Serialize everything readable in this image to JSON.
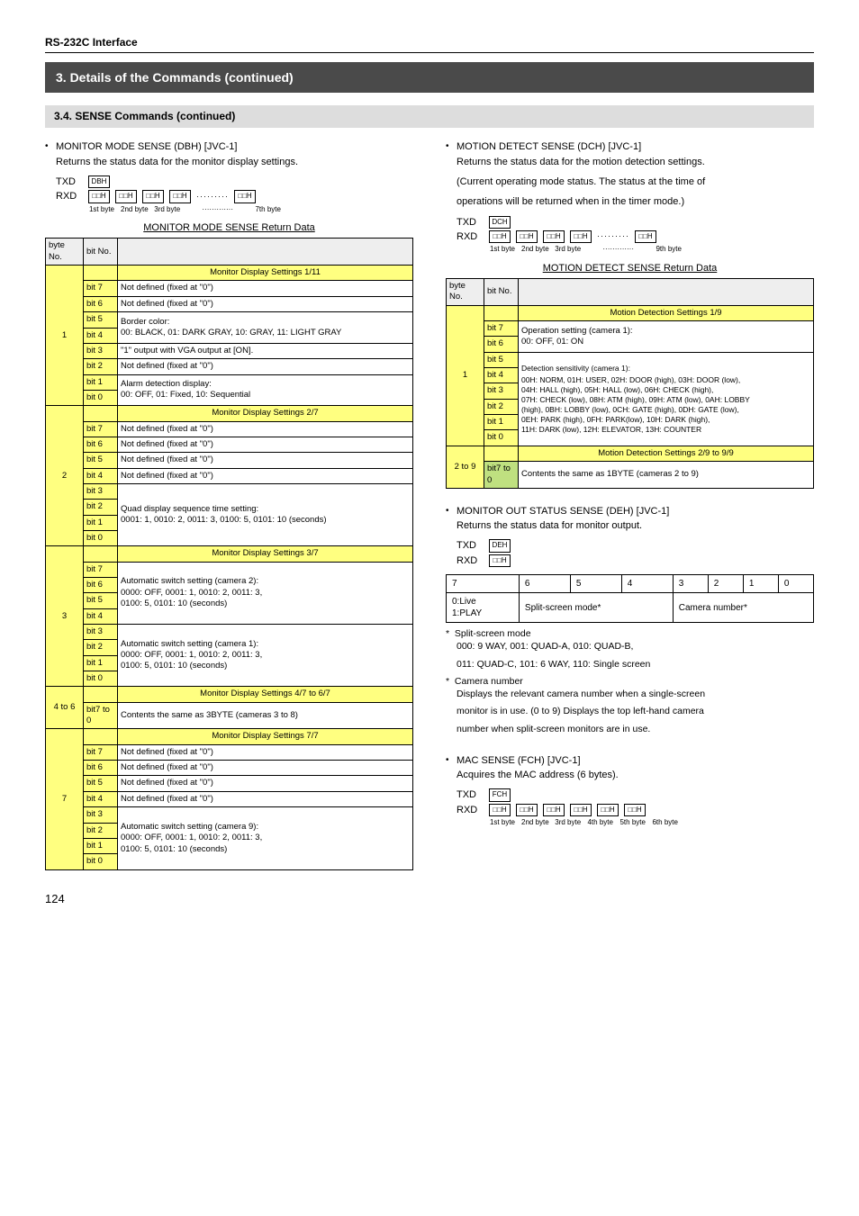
{
  "header": "RS-232C Interface",
  "title_bar": "3. Details of the Commands (continued)",
  "sub_bar": "3.4. SENSE Commands (continued)",
  "page_num": "124",
  "left": {
    "cmd_title": "MONITOR MODE SENSE (DBH) [JVC-1]",
    "cmd_desc": "Returns the status data for the monitor display settings.",
    "txd_hex": "DBH",
    "byte_labels": [
      "1st byte",
      "2nd byte",
      "3rd byte",
      "",
      "7th byte"
    ],
    "table_caption": "MONITOR MODE SENSE Return Data",
    "hdr_byte": "byte No.",
    "hdr_bit": "bit No.",
    "sections": [
      {
        "title": "Monitor Display Settings 1/11",
        "byte": "1",
        "rows": [
          {
            "bit": "bit 7",
            "desc": "Not defined (fixed at \"0\")"
          },
          {
            "bit": "bit 6",
            "desc": "Not defined (fixed at \"0\")"
          },
          {
            "bit": "bit 5",
            "desc": "Border color:",
            "merge_below": true
          },
          {
            "bit": "bit 4",
            "desc": "00: BLACK, 01: DARK GRAY, 10: GRAY, 11: LIGHT GRAY",
            "merged": true
          },
          {
            "bit": "bit 3",
            "desc": "\"1\" output with VGA output at [ON]."
          },
          {
            "bit": "bit 2",
            "desc": "Not defined (fixed at \"0\")"
          },
          {
            "bit": "bit 1",
            "desc": "Alarm detection display:",
            "merge_below": true
          },
          {
            "bit": "bit 0",
            "desc": "00: OFF, 01: Fixed, 10: Sequential",
            "merged": true
          }
        ]
      },
      {
        "title": "Monitor Display Settings 2/7",
        "byte": "2",
        "rows": [
          {
            "bit": "bit 7",
            "desc": "Not defined (fixed at \"0\")"
          },
          {
            "bit": "bit 6",
            "desc": "Not defined (fixed at \"0\")"
          },
          {
            "bit": "bit 5",
            "desc": "Not defined (fixed at \"0\")"
          },
          {
            "bit": "bit 4",
            "desc": "Not defined (fixed at \"0\")"
          },
          {
            "bit": "bit 3",
            "desc": "",
            "merge_below": true
          },
          {
            "bit": "bit 2",
            "desc": "Quad display sequence time setting:",
            "merge_below": true
          },
          {
            "bit": "bit 1",
            "desc": "0001: 1, 0010: 2, 0011: 3, 0100: 5, 0101: 10 (seconds)",
            "merged": true
          },
          {
            "bit": "bit 0",
            "desc": "",
            "merged": true
          }
        ]
      },
      {
        "title": "Monitor Display Settings 3/7",
        "byte": "3",
        "rows": [
          {
            "bit": "bit 7",
            "desc": "",
            "merge_below": true
          },
          {
            "bit": "bit 6",
            "desc": "Automatic switch setting (camera 2):",
            "merge_below": true
          },
          {
            "bit": "bit 5",
            "desc": "0000: OFF, 0001: 1, 0010: 2, 0011: 3,",
            "merge_below": true
          },
          {
            "bit": "bit 4",
            "desc": "0100: 5, 0101: 10 (seconds)",
            "merged": true
          },
          {
            "bit": "bit 3",
            "desc": "",
            "merge_below": true
          },
          {
            "bit": "bit 2",
            "desc": "Automatic switch setting (camera 1):",
            "merge_below": true
          },
          {
            "bit": "bit 1",
            "desc": "0000: OFF, 0001: 1, 0010: 2, 0011: 3,",
            "merge_below": true
          },
          {
            "bit": "bit 0",
            "desc": "0100: 5, 0101: 10 (seconds)",
            "merged": true
          }
        ]
      },
      {
        "title": "Monitor Display Settings 4/7 to 6/7",
        "byte": "4 to 6",
        "single_row": {
          "bit": "bit7 to 0",
          "desc": "Contents the same as 3BYTE (cameras 3 to 8)"
        }
      },
      {
        "title": "Monitor Display Settings 7/7",
        "byte": "7",
        "rows": [
          {
            "bit": "bit 7",
            "desc": "Not defined (fixed at \"0\")"
          },
          {
            "bit": "bit 6",
            "desc": "Not defined (fixed at \"0\")"
          },
          {
            "bit": "bit 5",
            "desc": "Not defined (fixed at \"0\")"
          },
          {
            "bit": "bit 4",
            "desc": "Not defined (fixed at \"0\")"
          },
          {
            "bit": "bit 3",
            "desc": "",
            "merge_below": true
          },
          {
            "bit": "bit 2",
            "desc": "Automatic switch setting (camera 9):",
            "merge_below": true
          },
          {
            "bit": "bit 1",
            "desc": "0000: OFF, 0001: 1, 0010: 2, 0011: 3,",
            "merge_below": true
          },
          {
            "bit": "bit 0",
            "desc": "0100: 5, 0101: 10 (seconds)",
            "merged": true
          }
        ]
      }
    ]
  },
  "right": {
    "motion": {
      "cmd_title": "MOTION DETECT SENSE (DCH) [JVC-1]",
      "cmd_desc1": "Returns the status data for the motion detection settings.",
      "cmd_desc2": "(Current operating mode status. The status at the time of",
      "cmd_desc3": "operations will be returned when in the timer mode.)",
      "txd_hex": "DCH",
      "byte_labels": [
        "1st byte",
        "2nd byte",
        "3rd byte",
        "",
        "9th byte"
      ],
      "table_caption": "MOTION DETECT SENSE Return Data",
      "hdr_byte": "byte No.",
      "hdr_bit": "bit No.",
      "sec1_title": "Motion Detection Settings 1/9",
      "sec1_byte": "1",
      "sec1_rows": [
        {
          "bit": "bit 7",
          "desc": "Operation setting (camera 1):"
        },
        {
          "bit": "bit 6",
          "desc": "00: OFF, 01: ON"
        },
        {
          "bit": "bit 5",
          "desc": "00H: NORM, 01H: USER, 02H: DOOR (high), 03H: DOOR (low),"
        },
        {
          "bit": "bit 4",
          "desc": "04H: HALL (high), 05H: HALL (low), 06H: CHECK (high),"
        },
        {
          "bit": "bit 3",
          "desc": "07H: CHECK (low), 08H: ATM (high), 09H: ATM (low), 0AH: LOBBY"
        },
        {
          "bit": "bit 2",
          "desc": "(high), 0BH: LOBBY (low), 0CH: GATE (high), 0DH: GATE (low),"
        },
        {
          "bit": "bit 1",
          "desc": "0EH: PARK (high), 0FH: PARK(low), 10H: DARK (high),"
        },
        {
          "bit": "bit 0",
          "desc": "11H: DARK (low), 12H: ELEVATOR, 13H: COUNTER"
        }
      ],
      "sec1_sensitivity": "Detection sensitivity (camera 1):",
      "sec2_title": "Motion Detection Settings 2/9 to 9/9",
      "sec2_byte": "2 to 9",
      "sec2_bit": "bit7 to 0",
      "sec2_desc": "Contents the same as 1BYTE (cameras 2 to 9)"
    },
    "monitor_out": {
      "cmd_title": "MONITOR OUT STATUS SENSE (DEH) [JVC-1]",
      "cmd_desc": "Returns the status data for monitor output.",
      "txd_hex": "DEH",
      "bits": [
        "7",
        "6",
        "5",
        "4",
        "3",
        "2",
        "1",
        "0"
      ],
      "r2c0a": "0:Live",
      "r2c0b": "1:PLAY",
      "r2c1": "Split-screen mode*",
      "r2c2": "Camera number*",
      "note1_title": "Split-screen mode",
      "note1_l1": "000: 9 WAY, 001: QUAD-A, 010: QUAD-B,",
      "note1_l2": "011: QUAD-C, 101: 6 WAY, 110: Single screen",
      "note2_title": "Camera number",
      "note2_l1": "Displays the relevant camera number when a single-screen",
      "note2_l2": "monitor is in use. (0 to 9) Displays the top left-hand camera",
      "note2_l3": "number when split-screen monitors are in use."
    },
    "mac": {
      "cmd_title": "MAC SENSE (FCH) [JVC-1]",
      "cmd_desc": "Acquires the MAC address (6 bytes).",
      "txd_hex": "FCH",
      "byte_labels": [
        "1st byte",
        "2nd byte",
        "3rd byte",
        "4th byte",
        "5th byte",
        "6th byte"
      ]
    }
  },
  "txd": "TXD",
  "rxd": "RXD"
}
